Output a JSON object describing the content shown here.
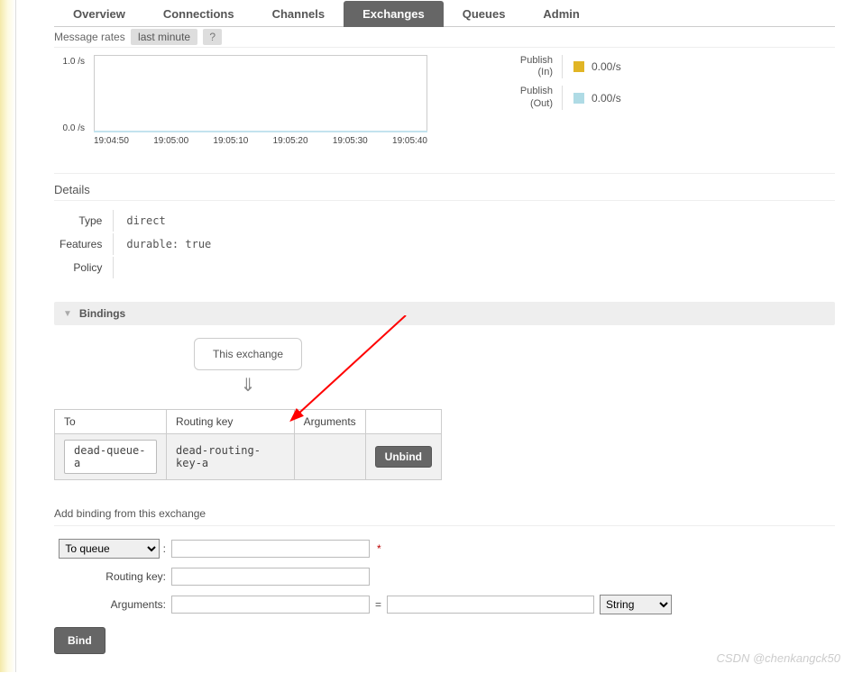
{
  "tabs": [
    "Overview",
    "Connections",
    "Channels",
    "Exchanges",
    "Queues",
    "Admin"
  ],
  "active_tab": "Exchanges",
  "rates": {
    "label": "Message rates",
    "pill": "last minute",
    "help": "?"
  },
  "chart_data": {
    "type": "line",
    "ylim": [
      0.0,
      1.0
    ],
    "y_unit": "/s",
    "x_ticks": [
      "19:04:50",
      "19:05:00",
      "19:05:10",
      "19:05:20",
      "19:05:30",
      "19:05:40"
    ],
    "series": [
      {
        "name": "Publish (In)",
        "value_label": "0.00/s",
        "color": "#e1b525"
      },
      {
        "name": "Publish (Out)",
        "value_label": "0.00/s",
        "color": "#afdbe5"
      }
    ]
  },
  "details": {
    "heading": "Details",
    "rows": {
      "type_label": "Type",
      "type_value": "direct",
      "features_label": "Features",
      "features_value": "durable: true",
      "policy_label": "Policy",
      "policy_value": ""
    }
  },
  "bindings": {
    "heading": "Bindings",
    "this_box": "This exchange",
    "columns": {
      "to": "To",
      "routing": "Routing key",
      "args": "Arguments"
    },
    "rows": [
      {
        "to": "dead-queue-a",
        "routing": "dead-routing-key-a",
        "args": "",
        "action": "Unbind"
      }
    ]
  },
  "add_binding": {
    "heading": "Add binding from this exchange",
    "dest_select": "To queue",
    "routing_label": "Routing key:",
    "args_label": "Arguments:",
    "type_select": "String",
    "submit": "Bind"
  },
  "watermark": "CSDN @chenkangck50"
}
